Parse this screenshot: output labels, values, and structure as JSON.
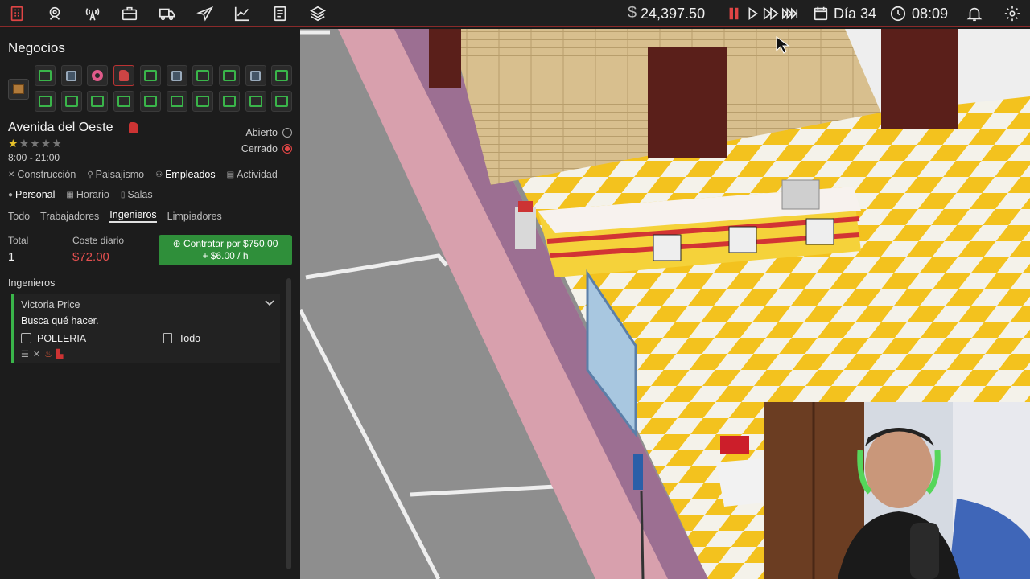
{
  "topbar": {
    "icons": [
      "building-icon",
      "map-pin-icon",
      "broadcast-icon",
      "briefcase-icon",
      "truck-icon",
      "airplane-icon",
      "chart-icon",
      "document-icon",
      "layers-icon"
    ],
    "money_sign": "$",
    "money": "24,397.50",
    "day": "Día 34",
    "time": "08:09",
    "accent": "#e04545"
  },
  "panel": {
    "title": "Negocios",
    "business": {
      "name": "Avenida del Oeste",
      "rating": 1,
      "rating_max": 5,
      "hours": "8:00 - 21:00",
      "open_label": "Abierto",
      "closed_label": "Cerrado",
      "state": "closed"
    },
    "main_tabs": [
      {
        "label": "Construcción",
        "icon": "hammer-icon"
      },
      {
        "label": "Paisajismo",
        "icon": "shovel-icon"
      },
      {
        "label": "Empleados",
        "icon": "people-icon"
      },
      {
        "label": "Actividad",
        "icon": "list-icon"
      }
    ],
    "sub_tabs": [
      {
        "label": "Personal",
        "icon": "person-icon"
      },
      {
        "label": "Horario",
        "icon": "calendar-icon"
      },
      {
        "label": "Salas",
        "icon": "door-icon"
      }
    ],
    "filter_tabs": [
      "Todo",
      "Trabajadores",
      "Ingenieros",
      "Limpiadores"
    ],
    "stats": {
      "total_label": "Total",
      "total": "1",
      "cost_label": "Coste diario",
      "cost": "$72.00",
      "hire_line1": "Contratar por $750.00",
      "hire_line2": "+ $6.00 / h"
    },
    "section_label": "Ingenieros",
    "employee": {
      "name": "Victoria Price",
      "status": "Busca qué hacer.",
      "location": "POLLERIA",
      "room": "Todo"
    }
  }
}
